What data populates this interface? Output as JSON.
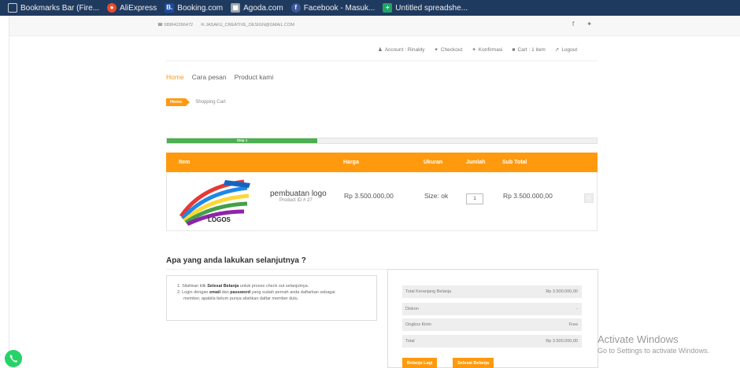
{
  "bookmarks": [
    {
      "label": "Bookmarks Bar (Fire...",
      "icon": "folder-icon",
      "color": "#cfcfcf"
    },
    {
      "label": "AliExpress",
      "icon": "aliexpress-icon",
      "color": "#e84b2b"
    },
    {
      "label": "Booking.com",
      "icon": "booking-icon",
      "color": "#1b4aa6",
      "glyph": "B."
    },
    {
      "label": "Agoda.com",
      "icon": "agoda-icon",
      "color": "#9aa3ab"
    },
    {
      "label": "Facebook - Masuk...",
      "icon": "facebook-icon",
      "color": "#3b5998",
      "glyph": "f"
    },
    {
      "label": "Untitled spreadshe...",
      "icon": "sheets-icon",
      "color": "#21a464",
      "glyph": "+"
    }
  ],
  "topbar": {
    "phone": "☎ 089642266472",
    "email": "✉ JASAKU_CREATIVE_DESIGN@GMAIL.COM",
    "social": [
      "f",
      "✦"
    ]
  },
  "account_nav": [
    {
      "icon": "♟",
      "label": "Account : Rinaldy"
    },
    {
      "icon": "✦",
      "label": "Checkout"
    },
    {
      "icon": "✦",
      "label": "Konfirmasi"
    },
    {
      "icon": "■",
      "label": "Cart : 1 item"
    },
    {
      "icon": "➚",
      "label": "Logout"
    }
  ],
  "main_nav": {
    "home": "Home",
    "cara_pesan": "Cara pesan",
    "product": "Product kami"
  },
  "breadcrumb": {
    "home": "Home",
    "current": "Shopping Cart"
  },
  "progress": {
    "label": "Step 1",
    "fraction": 0.35,
    "color": "#4caf50"
  },
  "cart": {
    "headers": {
      "item": "Item",
      "harga": "Harga",
      "ukuran": "Ukuran",
      "jumlah": "Jumlah",
      "subtotal": "Sub Total"
    },
    "rows": [
      {
        "image_label": "LOGOS",
        "name": "pembuatan logo",
        "product_id": "Product ID # 27",
        "price": "Rp 3.500.000,00",
        "size": "Size: ok",
        "qty": "1",
        "subtotal": "Rp 3.500.000,00"
      }
    ]
  },
  "next_steps": {
    "title": "Apa yang anda lakukan selanjutnya ?",
    "line1_a": "1. Silahkan klik ",
    "line1_b": "Selesai Belanja",
    "line1_c": " untuk proses check out selanjutnya.",
    "line2_a": "2. Login dengan ",
    "line2_b": "email",
    "line2_c": " dan ",
    "line2_d": "password",
    "line2_e": " yang sudah pernah anda daftarkan sebagai",
    "line2_f": "member, apabila belum punya silahkan daftar member dulu."
  },
  "summary": {
    "rows": [
      {
        "label": "Total Keranjang Belanja",
        "value": "Rp 3.500.000,00"
      },
      {
        "label": "Diskon",
        "value": "-"
      },
      {
        "label": "Ongkos Kirim",
        "value": "Free"
      },
      {
        "label": "Total",
        "value": "Rp 3.500.000,00"
      }
    ],
    "continue_label": "Belanja Lagi",
    "finish_label": "Selesai Belanja"
  },
  "watermark": {
    "title": "Activate Windows",
    "subtitle": "Go to Settings to activate Windows."
  },
  "colors": {
    "accent": "#ff9a0f",
    "bookmark_bar": "#1f3a5f",
    "whatsapp": "#25d366"
  }
}
